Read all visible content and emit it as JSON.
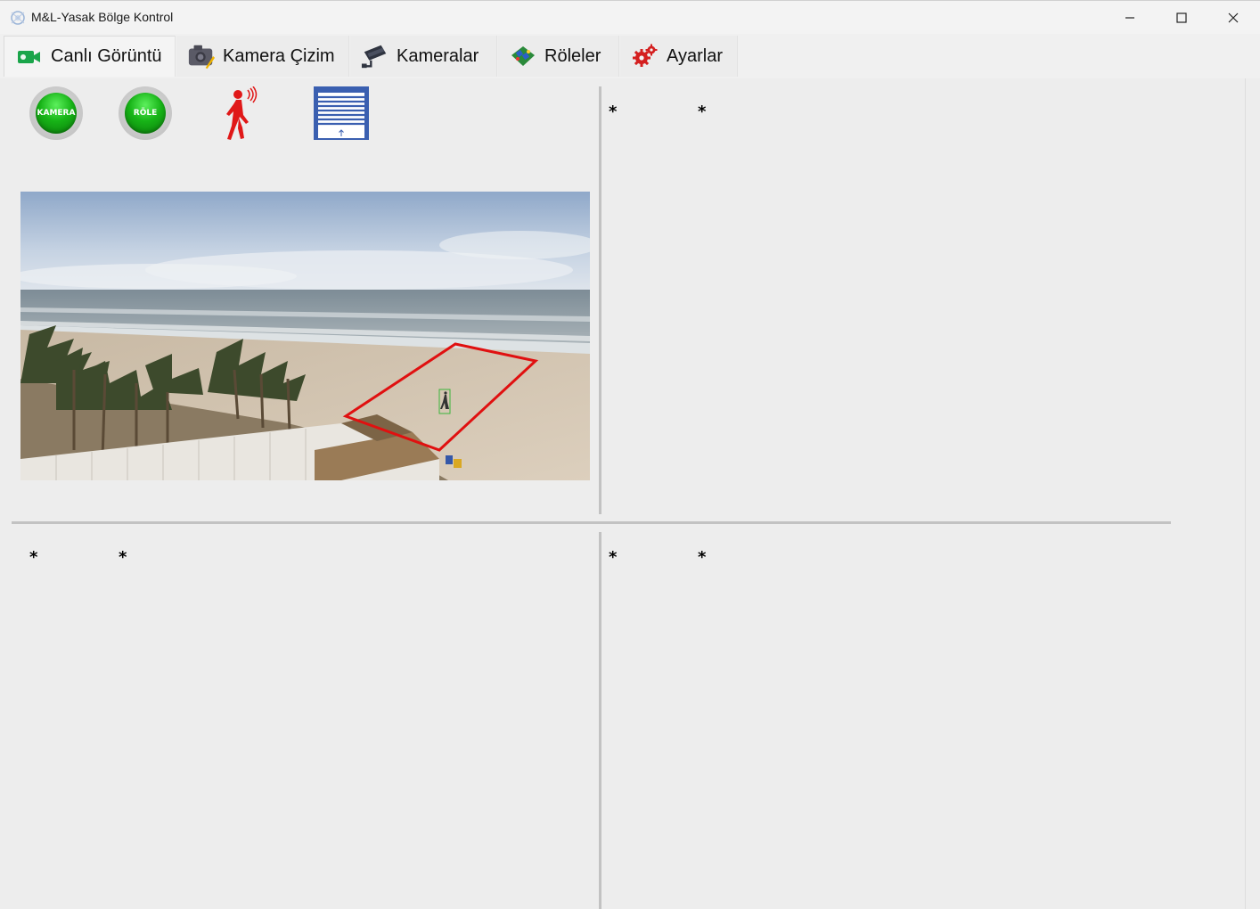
{
  "window": {
    "title": "M&L-Yasak Bölge Kontrol"
  },
  "tabs": [
    {
      "label": "Canlı Görüntü",
      "icon": "video-camera-icon",
      "active": true
    },
    {
      "label": "Kamera Çizim",
      "icon": "camera-draw-icon",
      "active": false
    },
    {
      "label": "Kameralar",
      "icon": "cctv-camera-icon",
      "active": false
    },
    {
      "label": "Röleler",
      "icon": "relay-board-icon",
      "active": false
    },
    {
      "label": "Ayarlar",
      "icon": "gears-icon",
      "active": false
    }
  ],
  "status": {
    "camera_label": "KAMERA",
    "relay_label": "RÖLE",
    "camera_color": "#17b417",
    "relay_color": "#17b417"
  },
  "panels": {
    "top_right": {
      "marker_1": "*",
      "marker_2": "*"
    },
    "bottom_left": {
      "marker_1": "*",
      "marker_2": "*"
    },
    "bottom_right": {
      "marker_1": "*",
      "marker_2": "*"
    }
  },
  "colors": {
    "zone_outline": "#e01010",
    "detection_box": "#3bb53b",
    "person_alert": "#e01818",
    "door_blue": "#3a5fb0"
  }
}
